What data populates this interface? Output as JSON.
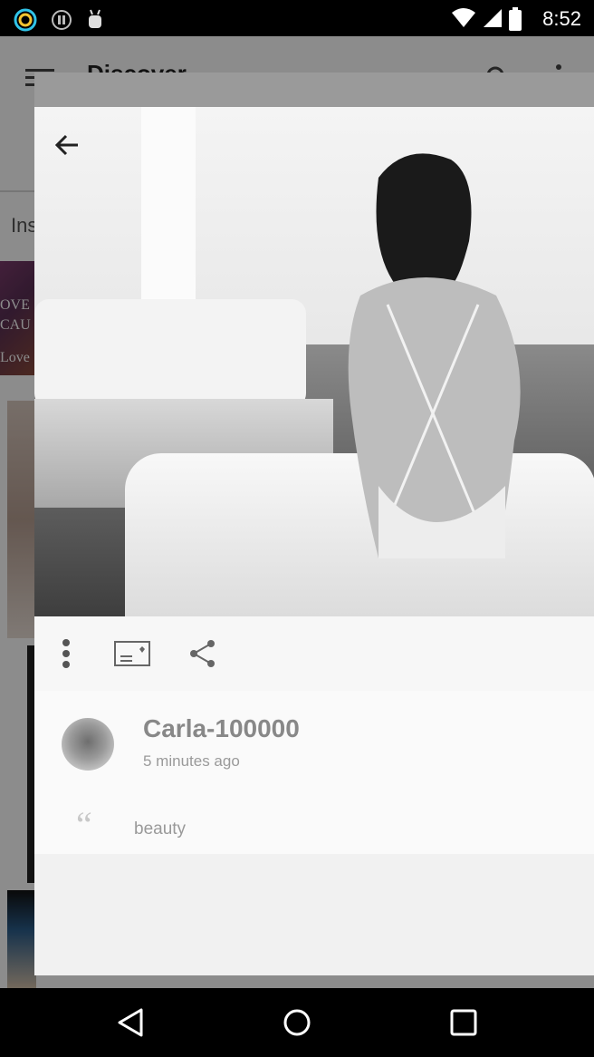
{
  "status_bar": {
    "time": "8:52",
    "icons": [
      "ring-icon",
      "pause-circle-icon",
      "android-debug-icon"
    ],
    "right_icons": [
      "wifi-icon",
      "signal-icon",
      "battery-icon"
    ]
  },
  "background_app": {
    "title": "Discover",
    "section_label": "Ins",
    "card_text_lines": [
      "OVE",
      "CAU",
      "Love"
    ]
  },
  "dialog": {
    "photo": {
      "description_icon": "photo"
    },
    "actions": [
      "more-vert-icon",
      "postcard-heart-icon",
      "share-icon"
    ],
    "comment": {
      "username": "Carla-100000",
      "time_ago": "5 minutes ago",
      "text": "beauty",
      "quote_glyph": "“"
    }
  },
  "nav_bar": {
    "buttons": [
      "back-icon",
      "home-icon",
      "recents-icon"
    ]
  },
  "colors": {
    "status_bar": "#000000",
    "dialog_bg": "#f2f2f2",
    "muted_text": "#999999"
  }
}
